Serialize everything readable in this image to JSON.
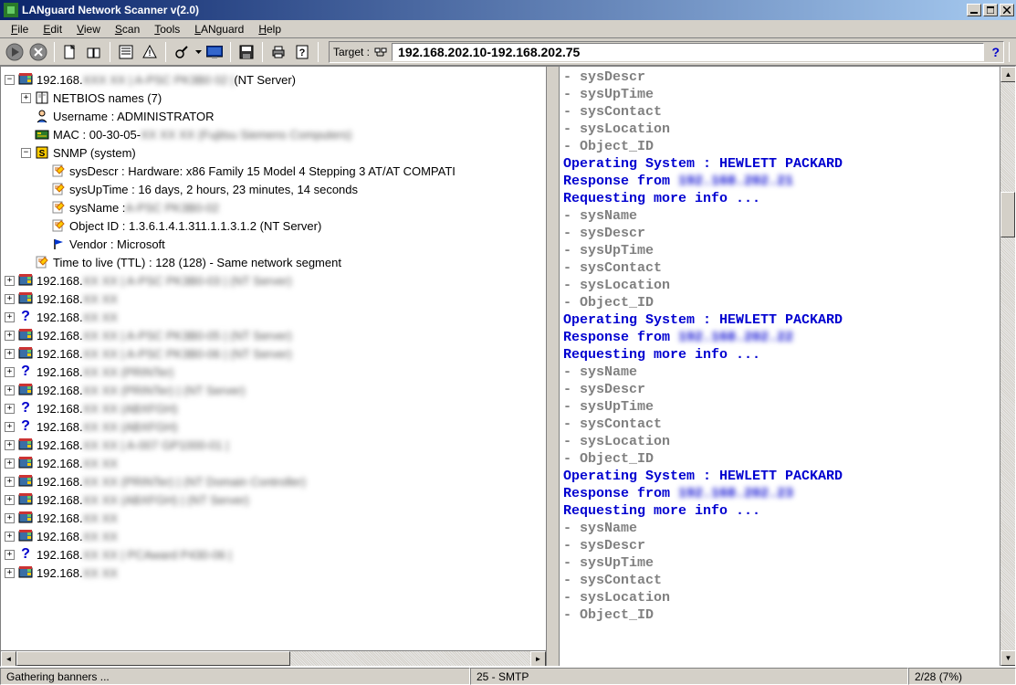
{
  "title": "LANguard Network Scanner v(2.0)",
  "menu": [
    "File",
    "Edit",
    "View",
    "Scan",
    "Tools",
    "LANguard",
    "Help"
  ],
  "menu_ul": [
    "F",
    "E",
    "V",
    "S",
    "T",
    "L",
    "H"
  ],
  "target_label": "Target :",
  "target_value": "192.168.202.10-192.168.202.75",
  "tree": {
    "root_ip": "192.168.",
    "root_blur": "XXX XX  | A-PSC PK3B0 02 |",
    "root_suffix": "(NT Server)",
    "netbios": "NETBIOS names (7)",
    "username": "Username : ADMINISTRATOR",
    "mac": "MAC : 00-30-05-",
    "mac_blur": "XX XX XX (Fujitsu Siemens Computers)",
    "snmp": "SNMP (system)",
    "snmp_items": [
      "sysDescr : Hardware: x86 Family 15 Model 4 Stepping 3 AT/AT COMPATI",
      "sysUpTime : 16 days, 2 hours, 23 minutes, 14 seconds",
      "sysName :",
      "Object ID : 1.3.6.1.4.1.311.1.1.3.1.2 (NT Server)",
      "Vendor : Microsoft"
    ],
    "snmp_name_blur": "A-PSC PK3B0-02",
    "ttl": "Time to live (TTL) : 128 (128) - Same network segment",
    "hosts": [
      {
        "ip": "192.168.",
        "blur": "XX XX | A-PSC PK3B0-03 | (NT Server)",
        "type": "win"
      },
      {
        "ip": "192.168.",
        "blur": "XX XX",
        "type": "win"
      },
      {
        "ip": "192.168.",
        "blur": "XX XX",
        "type": "q"
      },
      {
        "ip": "192.168.",
        "blur": "XX XX | A-PSC PK3B0-05 | (NT Server)",
        "type": "win"
      },
      {
        "ip": "192.168.",
        "blur": "XX XX | A-PSC PK3B0-06 | (NT Server)",
        "type": "win"
      },
      {
        "ip": "192.168.",
        "blur": "XX XX  (PRINTer)",
        "type": "q"
      },
      {
        "ip": "192.168.",
        "blur": "XX XX  (PRINTer) | (NT Server)",
        "type": "win"
      },
      {
        "ip": "192.168.",
        "blur": "XX XX  (ABXFGH)",
        "type": "q"
      },
      {
        "ip": "192.168.",
        "blur": "XX XX  (ABXFGH)",
        "type": "q"
      },
      {
        "ip": "192.168.",
        "blur": "XX XX  | A-007 GP1000-01 |",
        "type": "win"
      },
      {
        "ip": "192.168.",
        "blur": "XX XX",
        "type": "win"
      },
      {
        "ip": "192.168.",
        "blur": "XX XX  (PRINTer) | (NT Domain Controller)",
        "type": "win"
      },
      {
        "ip": "192.168.",
        "blur": "XX XX  (ABXFGH) | (NT Server)",
        "type": "win"
      },
      {
        "ip": "192.168.",
        "blur": "XX XX",
        "type": "win"
      },
      {
        "ip": "192.168.",
        "blur": "XX XX",
        "type": "win"
      },
      {
        "ip": "192.168.",
        "blur": "XX XX  | PCAward P430-06 |",
        "type": "q"
      },
      {
        "ip": "192.168.",
        "blur": "XX XX",
        "type": "win"
      }
    ]
  },
  "log_lines": [
    {
      "text": "- sysDescr",
      "cls": "gray"
    },
    {
      "text": "- sysUpTime",
      "cls": "gray"
    },
    {
      "text": "- sysContact",
      "cls": "gray"
    },
    {
      "text": "- sysLocation",
      "cls": "gray"
    },
    {
      "text": "- Object_ID",
      "cls": "gray"
    },
    {
      "text": "Operating System : HEWLETT PACKARD",
      "cls": "blue"
    },
    {
      "text": "Response from ",
      "cls": "blue",
      "ip": "192.168.202.21"
    },
    {
      "text": "Requesting more info ...",
      "cls": "blue"
    },
    {
      "text": "- sysName",
      "cls": "gray"
    },
    {
      "text": "- sysDescr",
      "cls": "gray"
    },
    {
      "text": "- sysUpTime",
      "cls": "gray"
    },
    {
      "text": "- sysContact",
      "cls": "gray"
    },
    {
      "text": "- sysLocation",
      "cls": "gray"
    },
    {
      "text": "- Object_ID",
      "cls": "gray"
    },
    {
      "text": "Operating System : HEWLETT PACKARD",
      "cls": "blue"
    },
    {
      "text": "Response from ",
      "cls": "blue",
      "ip": "192.168.202.22"
    },
    {
      "text": "Requesting more info ...",
      "cls": "blue"
    },
    {
      "text": "- sysName",
      "cls": "gray"
    },
    {
      "text": "- sysDescr",
      "cls": "gray"
    },
    {
      "text": "- sysUpTime",
      "cls": "gray"
    },
    {
      "text": "- sysContact",
      "cls": "gray"
    },
    {
      "text": "- sysLocation",
      "cls": "gray"
    },
    {
      "text": "- Object_ID",
      "cls": "gray"
    },
    {
      "text": "Operating System : HEWLETT PACKARD",
      "cls": "blue"
    },
    {
      "text": "Response from ",
      "cls": "blue",
      "ip": "192.168.202.23"
    },
    {
      "text": "Requesting more info ...",
      "cls": "blue"
    },
    {
      "text": "- sysName",
      "cls": "gray"
    },
    {
      "text": "- sysDescr",
      "cls": "gray"
    },
    {
      "text": "- sysUpTime",
      "cls": "gray"
    },
    {
      "text": "- sysContact",
      "cls": "gray"
    },
    {
      "text": "- sysLocation",
      "cls": "gray"
    },
    {
      "text": "- Object_ID",
      "cls": "gray"
    }
  ],
  "status": {
    "left": "Gathering banners ...",
    "mid": "25 - SMTP",
    "right": "2/28 (7%)"
  }
}
